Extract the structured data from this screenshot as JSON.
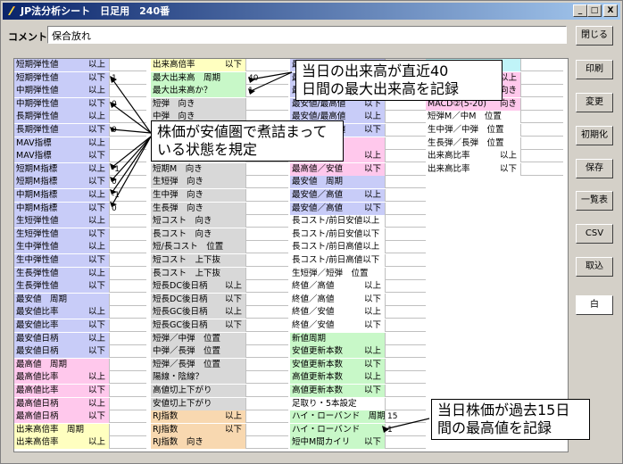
{
  "window": {
    "title": "JP法分析シート　日足用　240番",
    "minimize": "_",
    "maximize": "□",
    "close": "X"
  },
  "comment": {
    "label": "コメント",
    "value": "保合放れ"
  },
  "buttons": {
    "close": "閉じる",
    "print": "印刷",
    "change": "変更",
    "init": "初期化",
    "save": "保存",
    "list": "一覧表",
    "csv": "CSV",
    "import": "取込",
    "white": "白"
  },
  "col1": [
    {
      "label": "短期弾性値",
      "cond": "以上",
      "value": "",
      "group": "g-blue"
    },
    {
      "label": "短期弾性値",
      "cond": "以下",
      "value": "1",
      "group": "g-blue"
    },
    {
      "label": "中期弾性値",
      "cond": "以上",
      "value": "",
      "group": "g-blue"
    },
    {
      "label": "中期弾性値",
      "cond": "以下",
      "value": "0",
      "group": "g-blue"
    },
    {
      "label": "長期弾性値",
      "cond": "以上",
      "value": "",
      "group": "g-blue"
    },
    {
      "label": "長期弾性値",
      "cond": "以下",
      "value": "0",
      "group": "g-blue"
    },
    {
      "label": "MAV指標",
      "cond": "以上",
      "value": "",
      "group": "g-blue"
    },
    {
      "label": "MAV指標",
      "cond": "以下",
      "value": "",
      "group": "g-blue"
    },
    {
      "label": "短期M指標",
      "cond": "以上",
      "value": "-1",
      "group": "g-blue"
    },
    {
      "label": "短期M指標",
      "cond": "以下",
      "value": "0",
      "group": "g-blue"
    },
    {
      "label": "中期M指標",
      "cond": "以上",
      "value": "-1",
      "group": "g-blue"
    },
    {
      "label": "中期M指標",
      "cond": "以下",
      "value": "0",
      "group": "g-blue"
    },
    {
      "label": "生短弾性値",
      "cond": "以上",
      "value": "",
      "group": "g-blue"
    },
    {
      "label": "生短弾性値",
      "cond": "以下",
      "value": "",
      "group": "g-blue"
    },
    {
      "label": "生中弾性値",
      "cond": "以上",
      "value": "",
      "group": "g-blue"
    },
    {
      "label": "生中弾性値",
      "cond": "以下",
      "value": "",
      "group": "g-blue"
    },
    {
      "label": "生長弾性値",
      "cond": "以上",
      "value": "",
      "group": "g-blue"
    },
    {
      "label": "生長弾性値",
      "cond": "以下",
      "value": "",
      "group": "g-blue"
    },
    {
      "label": "最安値　周期",
      "cond": "",
      "value": "",
      "group": "g-blue"
    },
    {
      "label": "最安値比率",
      "cond": "以上",
      "value": "",
      "group": "g-blue"
    },
    {
      "label": "最安値比率",
      "cond": "以下",
      "value": "",
      "group": "g-blue"
    },
    {
      "label": "最安値日柄",
      "cond": "以上",
      "value": "",
      "group": "g-blue"
    },
    {
      "label": "最安値日柄",
      "cond": "以下",
      "value": "",
      "group": "g-blue"
    },
    {
      "label": "最高値　周期",
      "cond": "",
      "value": "",
      "group": "g-pink"
    },
    {
      "label": "最高値比率",
      "cond": "以上",
      "value": "",
      "group": "g-pink"
    },
    {
      "label": "最高値比率",
      "cond": "以下",
      "value": "",
      "group": "g-pink"
    },
    {
      "label": "最高値日柄",
      "cond": "以上",
      "value": "",
      "group": "g-pink"
    },
    {
      "label": "最高値日柄",
      "cond": "以下",
      "value": "",
      "group": "g-pink"
    },
    {
      "label": "出来高倍率　周期",
      "cond": "",
      "value": "",
      "group": "g-yellow"
    },
    {
      "label": "出来高倍率",
      "cond": "以上",
      "value": "",
      "group": "g-yellow"
    }
  ],
  "col2": [
    {
      "label": "出来高倍率",
      "cond": "以下",
      "value": "",
      "group": "g-yellow"
    },
    {
      "label": "最大出来高　周期",
      "cond": "",
      "value": "40",
      "group": "g-green"
    },
    {
      "label": "最大出来高か？",
      "cond": "",
      "value": "1",
      "group": "g-green"
    },
    {
      "label": "短弾　向き",
      "cond": "",
      "value": "",
      "group": "g-gray"
    },
    {
      "label": "中弾　向き",
      "cond": "",
      "value": "",
      "group": "g-gray"
    },
    {
      "label": "長弾　向き",
      "cond": "",
      "value": "",
      "group": "g-gray"
    },
    {
      "label": "",
      "cond": "",
      "value": "",
      "group": "g-gray"
    },
    {
      "label": "",
      "cond": "",
      "value": "",
      "group": "g-gray"
    },
    {
      "label": "短期M　向き",
      "cond": "",
      "value": "",
      "group": "g-gray"
    },
    {
      "label": "生短弾　向き",
      "cond": "",
      "value": "",
      "group": "g-gray"
    },
    {
      "label": "生中弾　向き",
      "cond": "",
      "value": "",
      "group": "g-gray"
    },
    {
      "label": "生長弾　向き",
      "cond": "",
      "value": "",
      "group": "g-gray"
    },
    {
      "label": "短コスト　向き",
      "cond": "",
      "value": "",
      "group": "g-gray"
    },
    {
      "label": "長コスト　向き",
      "cond": "",
      "value": "",
      "group": "g-gray"
    },
    {
      "label": "短/長コスト　位置",
      "cond": "",
      "value": "",
      "group": "g-gray"
    },
    {
      "label": "短コスト　上下抜",
      "cond": "",
      "value": "",
      "group": "g-gray"
    },
    {
      "label": "長コスト　上下抜",
      "cond": "",
      "value": "",
      "group": "g-gray"
    },
    {
      "label": "短長DC後日柄",
      "cond": "以上",
      "value": "",
      "group": "g-gray"
    },
    {
      "label": "短長DC後日柄",
      "cond": "以下",
      "value": "",
      "group": "g-gray"
    },
    {
      "label": "短長GC後日柄",
      "cond": "以上",
      "value": "",
      "group": "g-gray"
    },
    {
      "label": "短長GC後日柄",
      "cond": "以下",
      "value": "",
      "group": "g-gray"
    },
    {
      "label": "短弾／中弾　位置",
      "cond": "",
      "value": "",
      "group": "g-gray"
    },
    {
      "label": "中弾／長弾　位置",
      "cond": "",
      "value": "",
      "group": "g-gray"
    },
    {
      "label": "短弾／長弾　位置",
      "cond": "",
      "value": "",
      "group": "g-gray"
    },
    {
      "label": "陽線・陰線？",
      "cond": "",
      "value": "",
      "group": "g-gray"
    },
    {
      "label": "高値切上下がり",
      "cond": "",
      "value": "",
      "group": "g-gray"
    },
    {
      "label": "安値切上下がり",
      "cond": "",
      "value": "",
      "group": "g-gray"
    },
    {
      "label": "RJ指数",
      "cond": "以上",
      "value": "",
      "group": "g-orange"
    },
    {
      "label": "RJ指数",
      "cond": "以下",
      "value": "",
      "group": "g-orange"
    },
    {
      "label": "RJ指数　向き",
      "cond": "",
      "value": "",
      "group": "g-orange"
    }
  ],
  "col3": [
    {
      "label": "最",
      "cond": "",
      "value": "",
      "group": "g-blue"
    },
    {
      "label": "最",
      "cond": "",
      "value": "",
      "group": "g-blue"
    },
    {
      "label": "最",
      "cond": "",
      "value": "",
      "group": "g-blue"
    },
    {
      "label": "最安値/最高値",
      "cond": "以下",
      "value": "",
      "group": "g-blue"
    },
    {
      "label": "最安値/最高値",
      "cond": "以上",
      "value": "",
      "group": "g-blue"
    },
    {
      "label": "最安値/最高値",
      "cond": "以下",
      "value": "",
      "group": "g-blue"
    },
    {
      "label": "",
      "cond": "",
      "value": "",
      "group": "g-pink"
    },
    {
      "label": "",
      "cond": "以上",
      "value": "",
      "group": "g-pink"
    },
    {
      "label": "最高値／安値",
      "cond": "以下",
      "value": "",
      "group": "g-pink"
    },
    {
      "label": "最安値　周期",
      "cond": "",
      "value": "",
      "group": "g-blue"
    },
    {
      "label": "最安値／高値",
      "cond": "以上",
      "value": "",
      "group": "g-blue"
    },
    {
      "label": "最安値／高値",
      "cond": "以下",
      "value": "",
      "group": "g-blue"
    },
    {
      "label": "長コスト/前日安値以上",
      "cond": "",
      "value": "",
      "group": "g-white"
    },
    {
      "label": "長コスト/前日安値以下",
      "cond": "",
      "value": "",
      "group": "g-white"
    },
    {
      "label": "長コスト/前日高値以上",
      "cond": "",
      "value": "",
      "group": "g-white"
    },
    {
      "label": "長コスト/前日高値以下",
      "cond": "",
      "value": "",
      "group": "g-white"
    },
    {
      "label": "生短弾／短弾　位置",
      "cond": "",
      "value": "",
      "group": "g-white"
    },
    {
      "label": "終値／高値",
      "cond": "以上",
      "value": "",
      "group": "g-white"
    },
    {
      "label": "終値／高値",
      "cond": "以下",
      "value": "",
      "group": "g-white"
    },
    {
      "label": "終値／安値",
      "cond": "以上",
      "value": "",
      "group": "g-white"
    },
    {
      "label": "終値／安値",
      "cond": "以下",
      "value": "",
      "group": "g-white"
    },
    {
      "label": "新値周期",
      "cond": "",
      "value": "",
      "group": "g-green"
    },
    {
      "label": "安値更新本数",
      "cond": "以上",
      "value": "",
      "group": "g-green"
    },
    {
      "label": "安値更新本数",
      "cond": "以下",
      "value": "",
      "group": "g-green"
    },
    {
      "label": "高値更新本数",
      "cond": "以上",
      "value": "",
      "group": "g-green"
    },
    {
      "label": "高値更新本数",
      "cond": "以下",
      "value": "",
      "group": "g-green"
    },
    {
      "label": "足取り・5本設定",
      "cond": "",
      "value": "",
      "group": "g-white"
    },
    {
      "label": "ハイ・ローバンド　周期",
      "cond": "",
      "value": "15",
      "group": "g-green"
    },
    {
      "label": "ハイ・ローバンド",
      "cond": "",
      "value": "1",
      "group": "g-green"
    },
    {
      "label": "短中M間カイリ",
      "cond": "以下",
      "value": "",
      "group": "g-green"
    }
  ],
  "col4": [
    {
      "label": "",
      "cond": "",
      "value": "",
      "group": "g-cyan"
    },
    {
      "label": "",
      "cond": "以上",
      "value": "",
      "group": "g-pink"
    },
    {
      "label": "",
      "cond": "向き",
      "value": "",
      "group": "g-pink"
    },
    {
      "label": "MACD②(5-20)",
      "cond": "向き",
      "value": "",
      "group": "g-pink"
    },
    {
      "label": "短弾M／中M　位置",
      "cond": "",
      "value": "",
      "group": "g-white"
    },
    {
      "label": "生中弾／中弾　位置",
      "cond": "",
      "value": "",
      "group": "g-white"
    },
    {
      "label": "生長弾／長弾　位置",
      "cond": "",
      "value": "",
      "group": "g-white"
    },
    {
      "label": "出来高比率",
      "cond": "以上",
      "value": "",
      "group": "g-white"
    },
    {
      "label": "出来高比率",
      "cond": "以下",
      "value": "",
      "group": "g-white"
    }
  ],
  "callouts": {
    "volume": "当日の出来高が直近40\n日間の最大出来高を記録",
    "range": "株価が安値圏で煮詰まって\nいる状態を規定",
    "high": "当日株価が過去15日\n間の最高値を記録"
  }
}
